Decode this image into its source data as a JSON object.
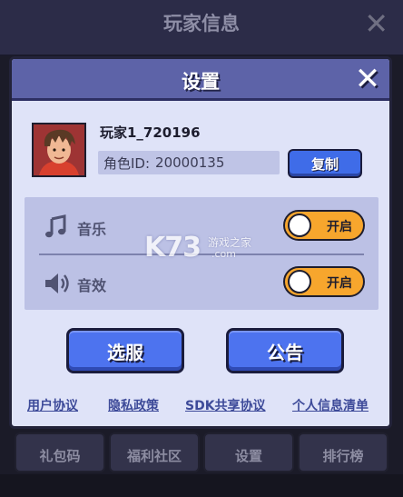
{
  "background": {
    "title": "玩家信息",
    "close_icon": "close-icon",
    "tabs": [
      "礼包码",
      "福利社区",
      "设置",
      "排行榜"
    ]
  },
  "settings": {
    "title": "设置",
    "close_icon": "close-icon",
    "player": {
      "avatar_icon": "player-avatar",
      "name": "玩家1_720196",
      "id_label": "角色ID:",
      "id_value": "20000135",
      "copy_label": "复制"
    },
    "audio": {
      "music": {
        "label": "音乐",
        "icon": "music-note-icon",
        "toggle_label": "开启",
        "enabled": true
      },
      "sound": {
        "label": "音效",
        "icon": "speaker-icon",
        "toggle_label": "开启",
        "enabled": true
      }
    },
    "buttons": {
      "server_label": "选服",
      "notice_label": "公告"
    },
    "links": [
      "用户协议",
      "隐私政策",
      "SDK共享协议",
      "个人信息清单"
    ]
  },
  "watermark": {
    "logo": "K73",
    "text": "游戏之家",
    "url": ".com"
  },
  "colors": {
    "panel_bg": "#dfe3f8",
    "header_bg": "#5d63a8",
    "button_blue": "#4d73ef",
    "toggle_on": "#f7a62d",
    "link": "#3d4a99"
  }
}
